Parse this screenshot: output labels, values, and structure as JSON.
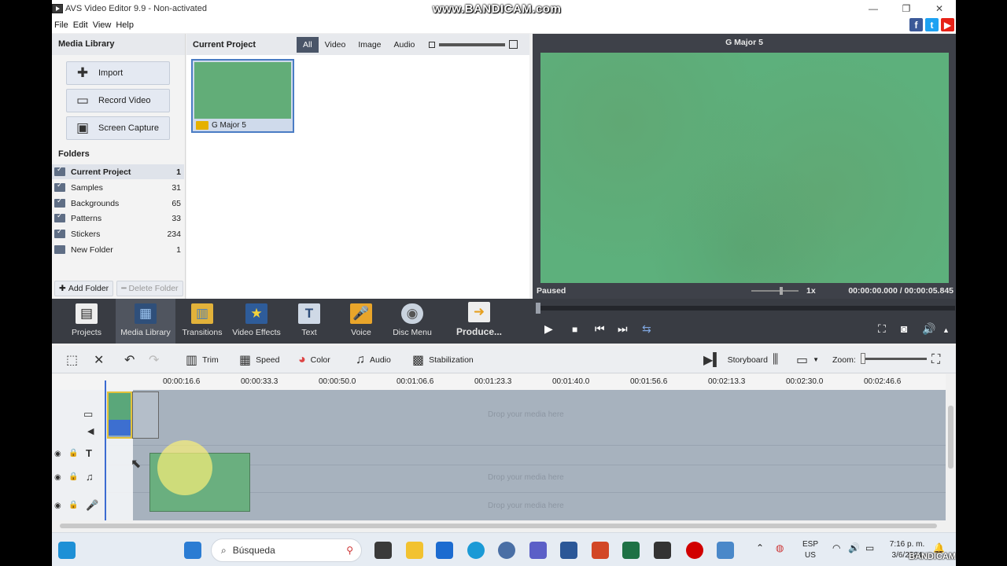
{
  "window": {
    "title": "AVS Video Editor 9.9 - Non-activated",
    "watermark": "www.BANDICAM.com"
  },
  "menu": [
    "File",
    "Edit",
    "View",
    "Help"
  ],
  "media_library": {
    "heading": "Media Library",
    "buttons": {
      "import": "Import",
      "record": "Record Video",
      "capture": "Screen Capture"
    },
    "folders_heading": "Folders",
    "folders": [
      {
        "name": "Current Project",
        "count": "1"
      },
      {
        "name": "Samples",
        "count": "31"
      },
      {
        "name": "Backgrounds",
        "count": "65"
      },
      {
        "name": "Patterns",
        "count": "33"
      },
      {
        "name": "Stickers",
        "count": "234"
      },
      {
        "name": "New Folder",
        "count": "1"
      }
    ],
    "add_folder": "Add Folder",
    "delete_folder": "Delete Folder"
  },
  "project": {
    "heading": "Current Project",
    "filters": [
      "All",
      "Video",
      "Image",
      "Audio"
    ],
    "active_filter": "All",
    "items": [
      {
        "name": "G Major 5"
      }
    ]
  },
  "preview": {
    "title": "G Major 5",
    "status": "Paused",
    "speed": "1x",
    "time": "00:00:00.000 / 00:00:05.845",
    "video_color": "#5db07c"
  },
  "main_toolbar": [
    {
      "label": "Projects",
      "icon": "clapperboard-icon"
    },
    {
      "label": "Media Library",
      "icon": "film-library-icon"
    },
    {
      "label": "Transitions",
      "icon": "transitions-icon"
    },
    {
      "label": "Video Effects",
      "icon": "star-effects-icon"
    },
    {
      "label": "Text",
      "icon": "text-T-icon"
    },
    {
      "label": "Voice",
      "icon": "microphone-icon"
    },
    {
      "label": "Disc Menu",
      "icon": "disc-icon"
    },
    {
      "label": "Produce...",
      "icon": "produce-icon"
    }
  ],
  "timeline_toolbar": {
    "trim": "Trim",
    "speed": "Speed",
    "color": "Color",
    "audio": "Audio",
    "stabilization": "Stabilization",
    "storyboard": "Storyboard",
    "zoom": "Zoom:"
  },
  "timeline": {
    "ticks": [
      "00:00:16.6",
      "00:00:33.3",
      "00:00:50.0",
      "00:01:06.6",
      "00:01:23.3",
      "00:01:40.0",
      "00:01:56.6",
      "00:02:13.3",
      "00:02:30.0",
      "00:02:46.6"
    ],
    "drop_text": "Drop your media here"
  },
  "taskbar": {
    "search_placeholder": "Búsqueda",
    "lang_top": "ESP",
    "lang_bottom": "US",
    "time": "7:16 p. m.",
    "date": "3/6/2024",
    "bandicam": "BANDICAM"
  }
}
